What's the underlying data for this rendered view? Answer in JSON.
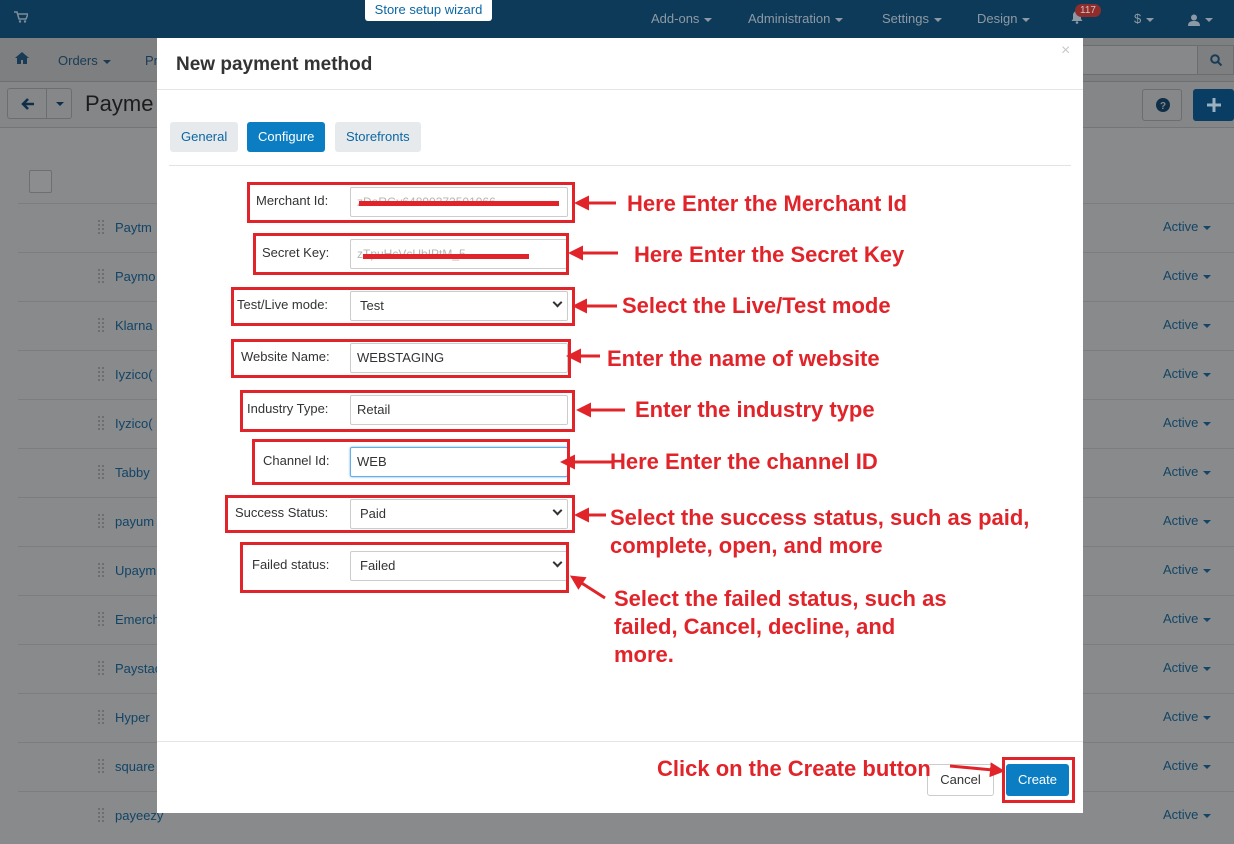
{
  "topbar": {
    "wizard": "Store setup wizard",
    "nav": [
      "Add-ons",
      "Administration",
      "Settings",
      "Design"
    ],
    "notifications_count": "117",
    "currency": "$"
  },
  "navbar": {
    "orders": "Orders",
    "products_partial": "Pr"
  },
  "page": {
    "title_partial": "Payme"
  },
  "list_rows": [
    {
      "name": "Paytm",
      "status": "Active"
    },
    {
      "name": "Paymo",
      "status": "Active"
    },
    {
      "name": "Klarna",
      "status": "Active"
    },
    {
      "name": "Iyzico(",
      "status": "Active"
    },
    {
      "name": "Iyzico(",
      "status": "Active"
    },
    {
      "name": "Tabby",
      "status": "Active"
    },
    {
      "name": "payum",
      "status": "Active"
    },
    {
      "name": "Upaym",
      "status": "Active"
    },
    {
      "name": "Emerch",
      "status": "Active"
    },
    {
      "name": "Paystac",
      "status": "Active"
    },
    {
      "name": "Hyper",
      "status": "Active"
    },
    {
      "name": "square",
      "status": "Active"
    },
    {
      "name": "payeezy",
      "status": "Active"
    }
  ],
  "modal": {
    "title": "New payment method",
    "close": "×",
    "tabs": [
      "General",
      "Configure",
      "Storefronts"
    ],
    "fields": {
      "merchant_id": {
        "label": "Merchant Id:",
        "value": "zDaRGv64890372501966"
      },
      "secret_key": {
        "label": "Secret Key:",
        "value": "zTpuHcVcUbIPtM_5"
      },
      "mode": {
        "label": "Test/Live mode:",
        "value": "Test"
      },
      "website": {
        "label": "Website Name:",
        "value": "WEBSTAGING"
      },
      "industry": {
        "label": "Industry Type:",
        "value": "Retail"
      },
      "channel": {
        "label": "Channel Id:",
        "value": "WEB"
      },
      "success": {
        "label": "Success Status:",
        "value": "Paid"
      },
      "failed": {
        "label": "Failed status:",
        "value": "Failed"
      }
    },
    "cancel": "Cancel",
    "create": "Create"
  },
  "annotations": {
    "merchant": "Here Enter the Merchant Id",
    "secret": "Here Enter the Secret Key",
    "mode": "Select the Live/Test mode",
    "website": "Enter the name of website",
    "industry": "Enter the industry type",
    "channel": "Here Enter the channel ID",
    "success_1": "Select the success status, such as paid,",
    "success_2": "complete, open, and more",
    "failed_1": "Select the failed status, such as",
    "failed_2": "failed, Cancel, decline, and",
    "failed_3": "more.",
    "create": "Click on the Create button"
  },
  "colors": {
    "accent": "#0b7ec3",
    "annotation": "#e1232a",
    "topbar": "#0e3a59"
  }
}
